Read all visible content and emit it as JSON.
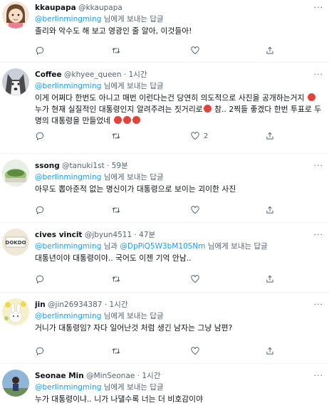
{
  "tweets": [
    {
      "name": "kkaupapa",
      "handle": "@kkaupapa",
      "sep": "",
      "time": "",
      "reply_mentions": [
        "@berlinmingming"
      ],
      "reply_joiner": "",
      "reply_suffix": "님에게 보내는 답글",
      "text": "졸리와 악수도 해 보고 영광인 줄 알아, 이것들아!",
      "replies": "",
      "retweets": "",
      "likes": "",
      "avatar": "cartoon-girl"
    },
    {
      "name": "Coffee",
      "handle": "@khyee_queen",
      "sep": "·",
      "time": "1시간",
      "reply_mentions": [
        "@berlinmingming"
      ],
      "reply_joiner": "",
      "reply_suffix": "님에게 보내는 답글",
      "text_parts": [
        "이게 어쩌다 한번도 아니고 매번 이런다는건 당연히 의도적으로 사진을 공개하는거지 ",
        " 누가 현재 실질적인 대통령인지 알려주려는 짓거리로",
        " 참.. 2찍들 좋겠다 한번 투표로 두명의 대통령을 만들었네 ",
        ""
      ],
      "replies": "",
      "retweets": "",
      "likes": "2",
      "avatar": "husky-dog"
    },
    {
      "name": "ssong",
      "handle": "@tanuki1st",
      "sep": "·",
      "time": "59분",
      "reply_mentions": [
        "@berlinmingming"
      ],
      "reply_joiner": "",
      "reply_suffix": "님에게 보내는 답글",
      "text": "아무도 뽑아준적 없는 명신이가 대통령으로 보이는 괴이한 사진",
      "replies": "",
      "retweets": "",
      "likes": "",
      "avatar": "green-bowl"
    },
    {
      "name": "cives vincit",
      "handle": "@jbyun4511",
      "sep": "·",
      "time": "47분",
      "reply_mentions": [
        "@berlinmingming",
        "@DpPiQ5W3bM10SNm"
      ],
      "reply_joiner": "님과",
      "reply_suffix": "님에게 보내는 답글",
      "text": "대통년이야 대통령이야.. 국어도 이젠 기억 안남..",
      "replies": "",
      "retweets": "",
      "likes": "",
      "avatar": "dokdo-sign",
      "avatar_text": "DOKDO"
    },
    {
      "name": "jin",
      "handle": "@jin26934387",
      "sep": "·",
      "time": "1시간",
      "reply_mentions": [
        "@berlinmingming"
      ],
      "reply_joiner": "",
      "reply_suffix": "님에게 보내는 답글",
      "text": "거니가 대통령임? 자다 일어난것 처럼 생긴 남자는 그냥 남편?",
      "replies": "",
      "retweets": "",
      "likes": "",
      "avatar": "bunny-flowers"
    },
    {
      "name": "Seonae Min",
      "handle": "@MinSeonae",
      "sep": "·",
      "time": "1시간",
      "reply_mentions": [
        "@berlinmingming"
      ],
      "reply_joiner": "",
      "reply_suffix": "님에게 보내는 답글",
      "text": "누가 대통령이냐.. 니가 나댈수록 너는 더 비호감이야",
      "replies": "",
      "retweets": "",
      "likes": "",
      "avatar": "person-sky"
    }
  ],
  "icons": {
    "reply": "reply-icon",
    "retweet": "retweet-icon",
    "like": "heart-icon",
    "share": "share-icon",
    "more": "more-icon",
    "emoji": "angry-face-emoji"
  },
  "colors": {
    "link": "#1d9bf0",
    "muted": "#536471",
    "text": "#0f1419",
    "divider": "#eff3f4",
    "emoji": "#e0453b"
  }
}
